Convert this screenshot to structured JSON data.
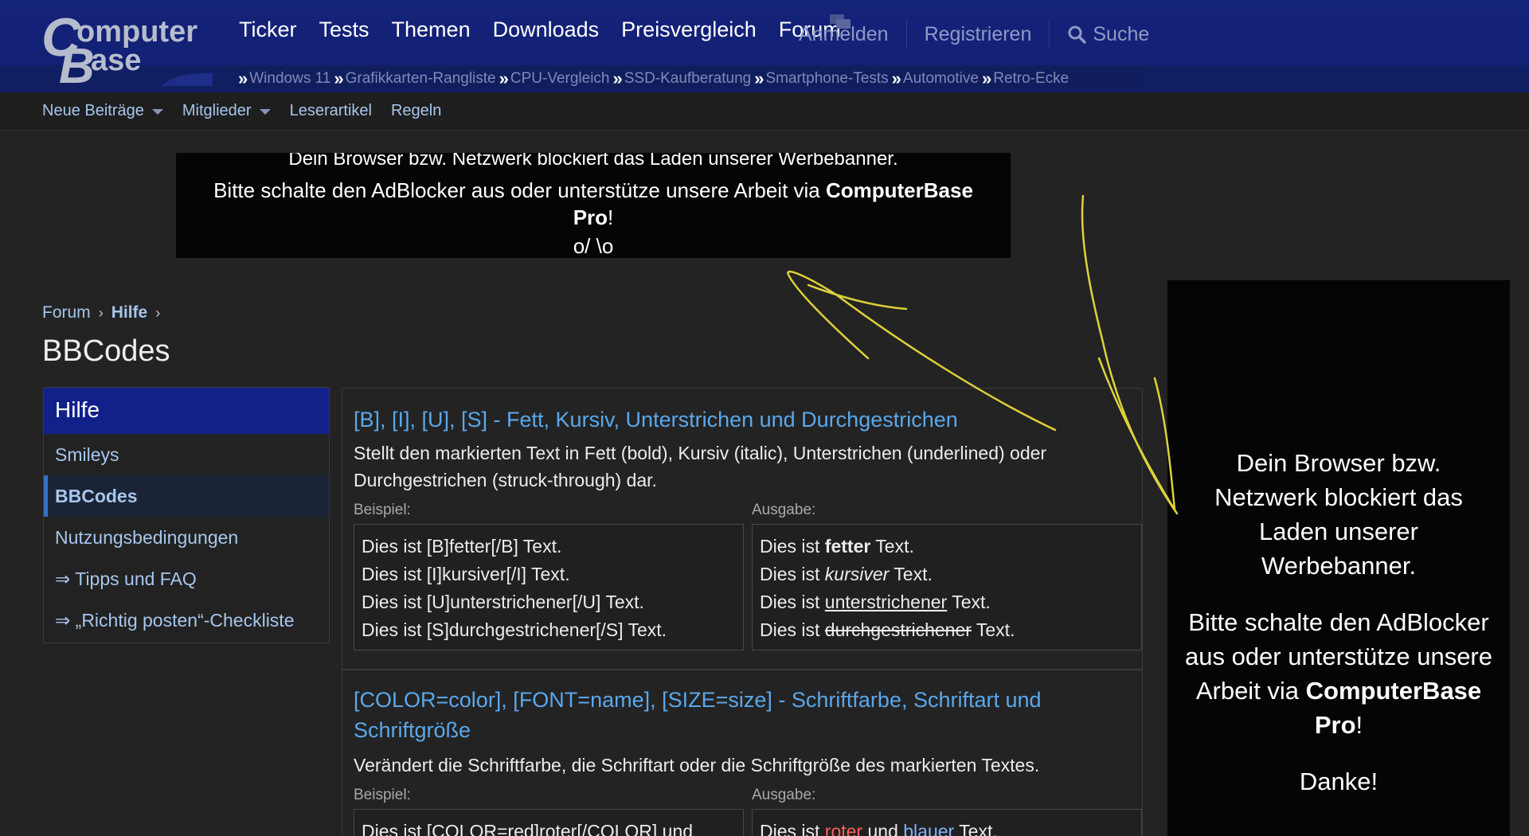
{
  "header": {
    "logo_text_line1": "Computer",
    "logo_text_line2": "Base",
    "nav": [
      "Ticker",
      "Tests",
      "Themen",
      "Downloads",
      "Preisvergleich",
      "Forum"
    ],
    "login": "Anmelden",
    "register": "Registrieren",
    "search": "Suche",
    "subnav": [
      "Windows 11",
      "Grafikkarten-Rangliste",
      "CPU-Vergleich",
      "SSD-Kaufberatung",
      "Smartphone-Tests",
      "Automotive",
      "Retro-Ecke"
    ],
    "brand_color": "#14237a"
  },
  "forumbar": {
    "new_posts": "Neue Beiträge",
    "members": "Mitglieder",
    "reader_articles": "Leserartikel",
    "rules": "Regeln"
  },
  "ad_top": {
    "line1": "Dein Browser bzw. Netzwerk blockiert das Laden unserer Werbebanner.",
    "line2_pre": "Bitte schalte den AdBlocker aus oder unterstütze unsere Arbeit via ",
    "line2_bold": "ComputerBase Pro",
    "line2_post": "!",
    "line3": "o/ \\o"
  },
  "breadcrumb": {
    "forum": "Forum",
    "help": "Hilfe"
  },
  "page_title": "BBCodes",
  "sidebar": {
    "heading": "Hilfe",
    "items": [
      {
        "label": "Smileys"
      },
      {
        "label": "BBCodes"
      },
      {
        "label": "Nutzungsbedingungen"
      },
      {
        "label": "⇒ Tipps und FAQ"
      },
      {
        "label": "⇒ „Richtig posten“-Checkliste"
      }
    ]
  },
  "sections": [
    {
      "title": "[B], [I], [U], [S] - Fett, Kursiv, Unterstrichen und Durchgestrichen",
      "description": "Stellt den markierten Text in Fett (bold), Kursiv (italic), Unterstrichen (underlined) oder Durchgestrichen (struck-through) dar.",
      "example_label": "Beispiel:",
      "output_label": "Ausgabe:",
      "examples": [
        "Dies ist [B]fetter[/B] Text.",
        "Dies ist [I]kursiver[/I] Text.",
        "Dies ist [U]unterstrichener[/U] Text.",
        "Dies ist [S]durchgestrichener[/S] Text."
      ],
      "output_prefix": "Dies ist ",
      "output_suffix": " Text.",
      "outputs": [
        "fetter",
        "kursiver",
        "unterstrichener",
        "durchgestrichener"
      ]
    },
    {
      "title": "[COLOR=color], [FONT=name], [SIZE=size] - Schriftfarbe, Schriftart und Schriftgröße",
      "description": "Verändert die Schriftfarbe, die Schriftart oder die Schriftgröße des markierten Textes.",
      "example_label": "Beispiel:",
      "output_label": "Ausgabe:",
      "example_first": "Dies ist [COLOR=red]roter[/COLOR] und",
      "output_pre": "Dies ist ",
      "output_red": "roter",
      "output_mid": " und ",
      "output_blue": "blauer",
      "output_post": " Text."
    }
  ],
  "ad_right": {
    "p1": "Dein Browser bzw. Netzwerk blockiert das Laden unserer Werbebanner.",
    "p2_pre": "Bitte schalte den AdBlocker aus oder unterstütze unsere Arbeit via ",
    "p2_bold": "ComputerBase Pro",
    "p2_post": "!",
    "p3": "Danke!"
  },
  "colors": {
    "link": "#a6c6ec",
    "section_title": "#5aa8ec",
    "annotation": "#e0d23a"
  }
}
